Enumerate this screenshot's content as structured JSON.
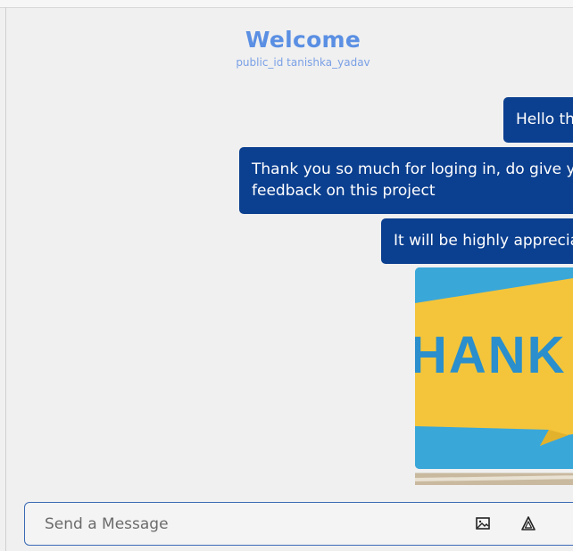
{
  "header": {
    "title": "Welcome",
    "subtitle": "public_id tanishka_yadav"
  },
  "messages": [
    {
      "text": "Hello th"
    },
    {
      "text": "Thank you so much for loging in, do give y",
      "text2": "feedback on this project"
    },
    {
      "text": "It will be highly apprecia"
    }
  ],
  "image_message": {
    "caption_text": "HANK Y"
  },
  "composer": {
    "placeholder": "Send a Message",
    "icons": [
      "image-icon",
      "send-icon"
    ]
  },
  "colors": {
    "bubble": "#0b3f8f",
    "title": "#5a8fe3",
    "subtitle": "#7aa0e6",
    "background": "#f0f0f0",
    "input_border": "#3b6ab5"
  }
}
